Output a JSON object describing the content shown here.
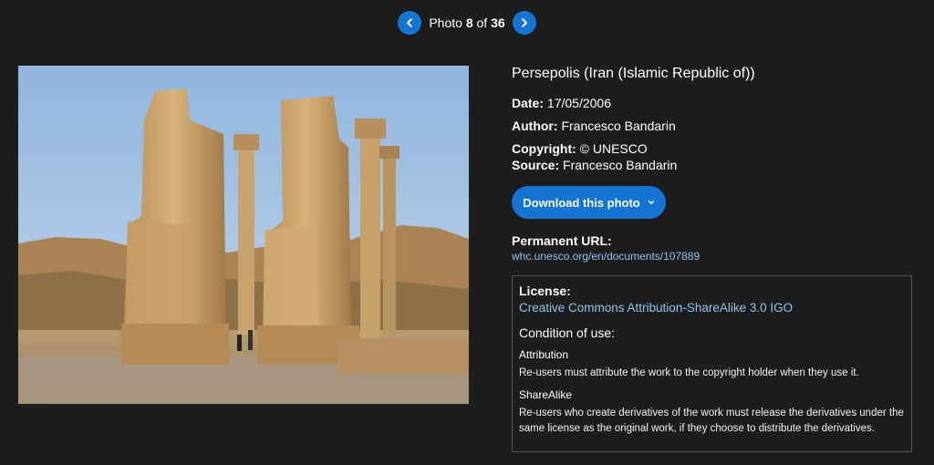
{
  "pager": {
    "prefix": "Photo",
    "current": "8",
    "of": "of",
    "total": "36",
    "prev_icon": "chevron-left-icon",
    "next_icon": "chevron-right-icon"
  },
  "photo": {
    "subject": "Persepolis ruins"
  },
  "info": {
    "title": "Persepolis (Iran (Islamic Republic of))",
    "date_label": "Date:",
    "date_value": "17/05/2006",
    "author_label": "Author:",
    "author_value": "Francesco Bandarin",
    "copyright_label": "Copyright:",
    "copyright_value": "© UNESCO",
    "source_label": "Source:",
    "source_value": "Francesco Bandarin"
  },
  "download": {
    "label": "Download this photo",
    "chevron_icon": "chevron-down-icon"
  },
  "permanent": {
    "label": "Permanent URL:",
    "url": "whc.unesco.org/en/documents/107889"
  },
  "license": {
    "label": "License:",
    "name": "Creative Commons Attribution-ShareAlike 3.0 IGO",
    "condition_label": "Condition of use:",
    "conditions": [
      {
        "title": "Attribution",
        "text": "Re-users must attribute the work to the copyright holder when they use it."
      },
      {
        "title": "ShareAlike",
        "text": "Re-users who create derivatives of the work must release the derivatives under the same license as the original work, if they choose to distribute the derivatives."
      }
    ]
  },
  "colors": {
    "background": "#1d1d1d",
    "accent": "#1575d5",
    "link": "#8dc3f0"
  }
}
